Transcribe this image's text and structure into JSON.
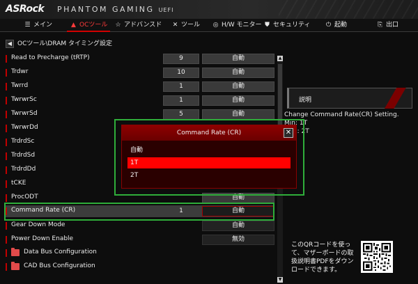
{
  "header": {
    "logo": "ASRock",
    "subtitle": "PHANTOM GAMING",
    "uefi": "UEFI"
  },
  "nav": {
    "items": [
      {
        "label": "メイン",
        "icon": "grid-icon"
      },
      {
        "label": "OCツール",
        "icon": "flame-icon"
      },
      {
        "label": "アドバンスド",
        "icon": "star-icon"
      },
      {
        "label": "ツール",
        "icon": "tools-icon"
      },
      {
        "label": "H/W モニター",
        "icon": "monitor-icon"
      },
      {
        "label": "セキュリティ",
        "icon": "shield-icon"
      },
      {
        "label": "起動",
        "icon": "power-icon"
      },
      {
        "label": "出口",
        "icon": "exit-icon"
      }
    ]
  },
  "breadcrumb": "OCツール\\DRAM タイミング設定",
  "rows": [
    {
      "label": "Read to Precharge (tRTP)",
      "value": "9",
      "option": "自動"
    },
    {
      "label": "Trdwr",
      "value": "10",
      "option": "自動"
    },
    {
      "label": "Twrrd",
      "value": "1",
      "option": "自動"
    },
    {
      "label": "TwrwrSc",
      "value": "1",
      "option": "自動"
    },
    {
      "label": "TwrwrSd",
      "value": "5",
      "option": "自動"
    },
    {
      "label": "TwrwrDd",
      "value": "",
      "option": ""
    },
    {
      "label": "TrdrdSc",
      "value": "",
      "option": ""
    },
    {
      "label": "TrdrdSd",
      "value": "",
      "option": ""
    },
    {
      "label": "TrdrdDd",
      "value": "",
      "option": ""
    },
    {
      "label": "tCKE",
      "value": "",
      "option": ""
    },
    {
      "label": "ProcODT",
      "value": "",
      "option": "自動"
    },
    {
      "label": "Command Rate (CR)",
      "value": "1",
      "option": "自動"
    },
    {
      "label": "Gear Down Mode",
      "value": "",
      "option": "自動"
    },
    {
      "label": "Power Down Enable",
      "value": "",
      "option": "無効"
    },
    {
      "label": "Data Bus Configuration",
      "value": "",
      "option": ""
    },
    {
      "label": "CAD Bus Configuration",
      "value": "",
      "option": ""
    }
  ],
  "help": {
    "title": "説明",
    "lines": [
      "Change Command Rate(CR) Setting.",
      "Min: 1T",
      "Max: 2T"
    ]
  },
  "qr": {
    "text": "このQRコードを使って、マザーボードの取扱説明書PDFをダウンロードできます。"
  },
  "modal": {
    "title": "Command Rate (CR)",
    "close": "✕",
    "options": [
      "自動",
      "1T",
      "2T"
    ],
    "selected": "1T"
  }
}
